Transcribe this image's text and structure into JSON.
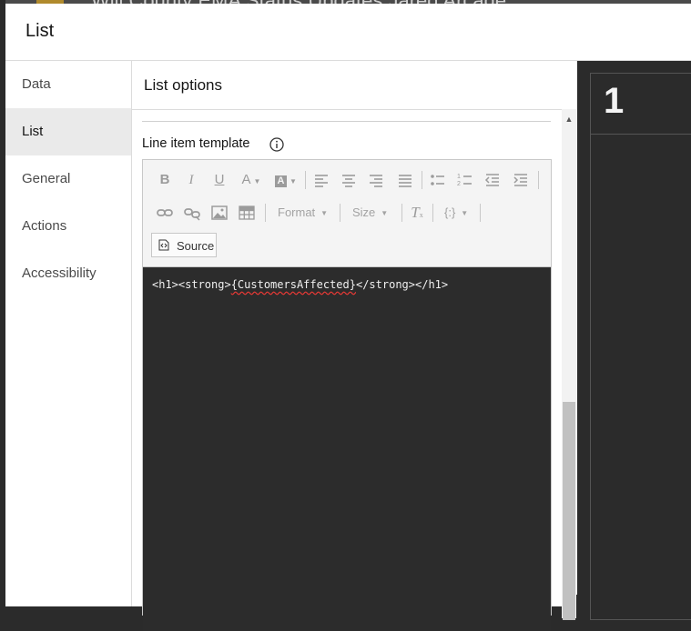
{
  "background": {
    "title": "Will County EMA Status Updates Jared Arcade"
  },
  "dialog": {
    "title": "List"
  },
  "sidebar": {
    "items": [
      {
        "label": "Data",
        "active": false
      },
      {
        "label": "List",
        "active": true
      },
      {
        "label": "General",
        "active": false
      },
      {
        "label": "Actions",
        "active": false
      },
      {
        "label": "Accessibility",
        "active": false
      }
    ]
  },
  "panel": {
    "title": "List options",
    "field_label": "Line item template",
    "info_icon": "info-icon"
  },
  "toolbar": {
    "format_label": "Format",
    "size_label": "Size",
    "field_token": "{:}",
    "source_label": "Source",
    "icons": [
      "bold-icon",
      "italic-icon",
      "underline-icon",
      "text-color-icon",
      "background-color-icon",
      "align-left-icon",
      "align-center-icon",
      "align-right-icon",
      "justify-icon",
      "bullet-list-icon",
      "numbered-list-icon",
      "decrease-indent-icon",
      "increase-indent-icon",
      "link-icon",
      "unlink-icon",
      "image-icon",
      "table-icon",
      "remove-format-icon",
      "source-icon"
    ]
  },
  "code": {
    "before": "<h1><strong>",
    "token": "{CustomersAffected}",
    "after": "</strong></h1>"
  },
  "preview": {
    "value": "1"
  },
  "colors": {
    "dialog_bg": "#ffffff",
    "active_nav": "#eaeaea",
    "code_bg": "#2c2c2c",
    "preview_bg": "#2b2b2b"
  }
}
